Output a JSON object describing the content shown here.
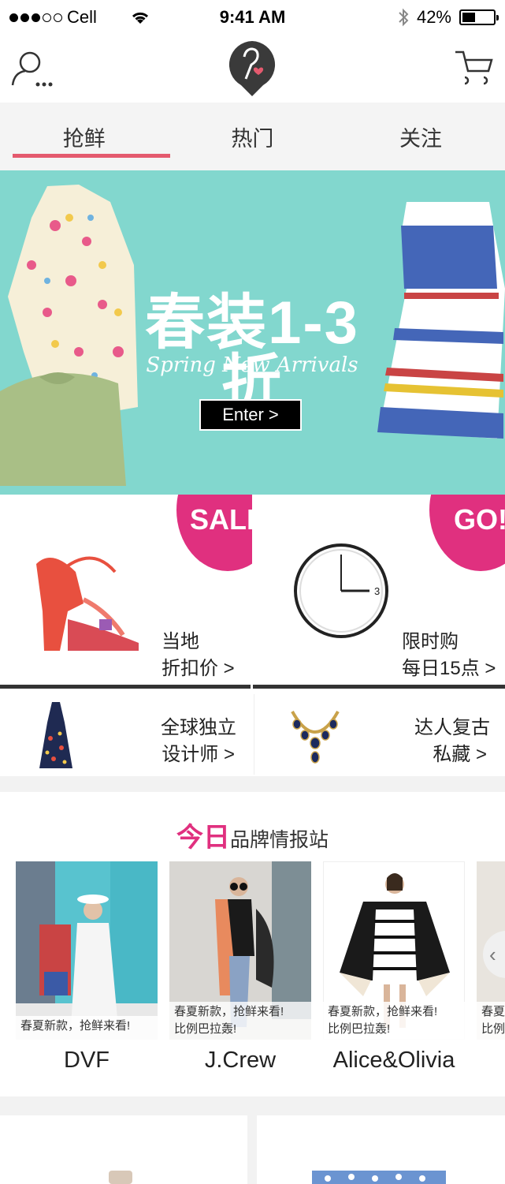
{
  "status_bar": {
    "carrier": "Cell",
    "time": "9:41 AM",
    "battery": "42%",
    "battery_level": 0.42
  },
  "header": {
    "icons": [
      "user-more-icon",
      "hanger-heart-logo",
      "cart-icon"
    ]
  },
  "tabs": [
    {
      "label": "抢鲜",
      "active": true
    },
    {
      "label": "热门",
      "active": false
    },
    {
      "label": "关注",
      "active": false
    }
  ],
  "banner": {
    "title": "春装1-3折",
    "subtitle": "Spring New Arrivals",
    "button": "Enter >"
  },
  "features": [
    {
      "badge": "SALE",
      "line1": "当地",
      "line2": "折扣价 >"
    },
    {
      "badge": "GO!",
      "line1": "限时购",
      "line2": "每日15点 >"
    },
    {
      "line1": "全球独立",
      "line2": "设计师 >"
    },
    {
      "line1": "达人复古",
      "line2": "私藏  >"
    }
  ],
  "brand_section": {
    "heading_highlight": "今日",
    "heading": "品牌情报站",
    "brands": [
      {
        "name": "DVF",
        "caption_1": "春夏新款，抢鲜来看!",
        "caption_2": ""
      },
      {
        "name": "J.Crew",
        "caption_1": "春夏新款，抢鲜来看!",
        "caption_2": "比例巴拉轰!"
      },
      {
        "name": "Alice&Olivia",
        "caption_1": "春夏新款，抢鲜来看!",
        "caption_2": "比例巴拉轰!"
      },
      {
        "name": "",
        "caption_1": "春夏",
        "caption_2": "比例"
      }
    ],
    "scroll_arrow": "‹"
  },
  "colors": {
    "accent": "#e0307f",
    "tab_underline": "#e45a6e",
    "banner_bg": "#82d7ce"
  }
}
